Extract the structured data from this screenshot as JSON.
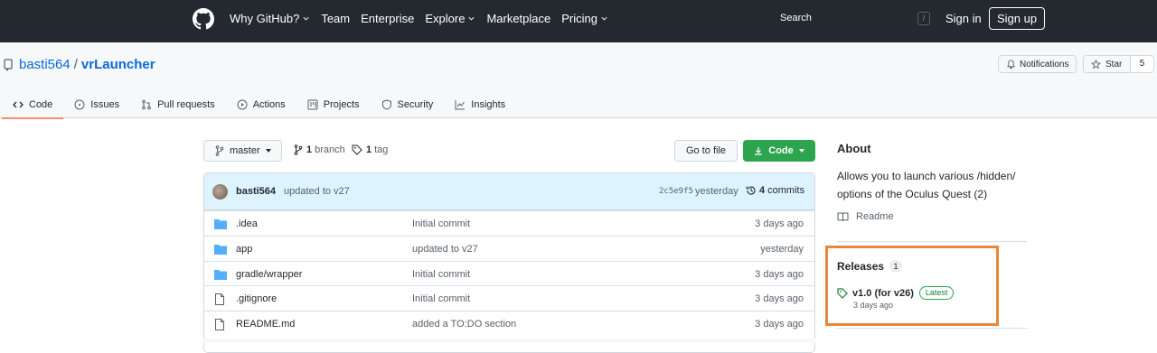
{
  "header": {
    "nav": [
      {
        "label": "Why GitHub?",
        "dropdown": true
      },
      {
        "label": "Team",
        "dropdown": false
      },
      {
        "label": "Enterprise",
        "dropdown": false
      },
      {
        "label": "Explore",
        "dropdown": true
      },
      {
        "label": "Marketplace",
        "dropdown": false
      },
      {
        "label": "Pricing",
        "dropdown": true
      }
    ],
    "search_placeholder": "Search",
    "search_shortcut": "/",
    "signin": "Sign in",
    "signup": "Sign up"
  },
  "repo": {
    "owner": "basti564",
    "separator": "/",
    "name": "vrLauncher",
    "notifications_label": "Notifications",
    "star_label": "Star",
    "star_count": "5"
  },
  "tabs": [
    {
      "label": "Code",
      "icon": "code-icon",
      "active": true
    },
    {
      "label": "Issues",
      "icon": "issue-icon",
      "active": false
    },
    {
      "label": "Pull requests",
      "icon": "pull-request-icon",
      "active": false
    },
    {
      "label": "Actions",
      "icon": "play-icon",
      "active": false
    },
    {
      "label": "Projects",
      "icon": "project-icon",
      "active": false
    },
    {
      "label": "Security",
      "icon": "shield-icon",
      "active": false
    },
    {
      "label": "Insights",
      "icon": "graph-icon",
      "active": false
    }
  ],
  "toolbar": {
    "branch": "master",
    "branch_count": "1",
    "branch_label": "branch",
    "tag_count": "1",
    "tag_label": "tag",
    "go_to_file": "Go to file",
    "code": "Code"
  },
  "latest_commit": {
    "user": "basti564",
    "message": "updated to v27",
    "hash": "2c5e9f5",
    "time": "yesterday",
    "commit_count": "4",
    "commit_label": "commits"
  },
  "files": [
    {
      "name": ".idea",
      "type": "folder",
      "message": "Initial commit",
      "age": "3 days ago"
    },
    {
      "name": "app",
      "type": "folder",
      "message": "updated to v27",
      "age": "yesterday"
    },
    {
      "name": "gradle/wrapper",
      "type": "folder",
      "message": "Initial commit",
      "age": "3 days ago"
    },
    {
      "name": ".gitignore",
      "type": "file",
      "message": "Initial commit",
      "age": "3 days ago"
    },
    {
      "name": "README.md",
      "type": "file",
      "message": "added a TO:DO section",
      "age": "3 days ago"
    }
  ],
  "about": {
    "title": "About",
    "description": "Allows you to launch various /hidden/ options of the Oculus Quest (2)",
    "readme": "Readme"
  },
  "releases": {
    "title": "Releases",
    "count": "1",
    "latest_name": "v1.0 (for v26)",
    "latest_badge": "Latest",
    "latest_date": "3 days ago"
  },
  "colors": {
    "header_bg": "#24292f",
    "accent_blue": "#0969da",
    "code_button": "#2da44e",
    "active_tab": "#fd8c73",
    "highlight_box": "#e8873a",
    "folder": "#54aeff"
  }
}
